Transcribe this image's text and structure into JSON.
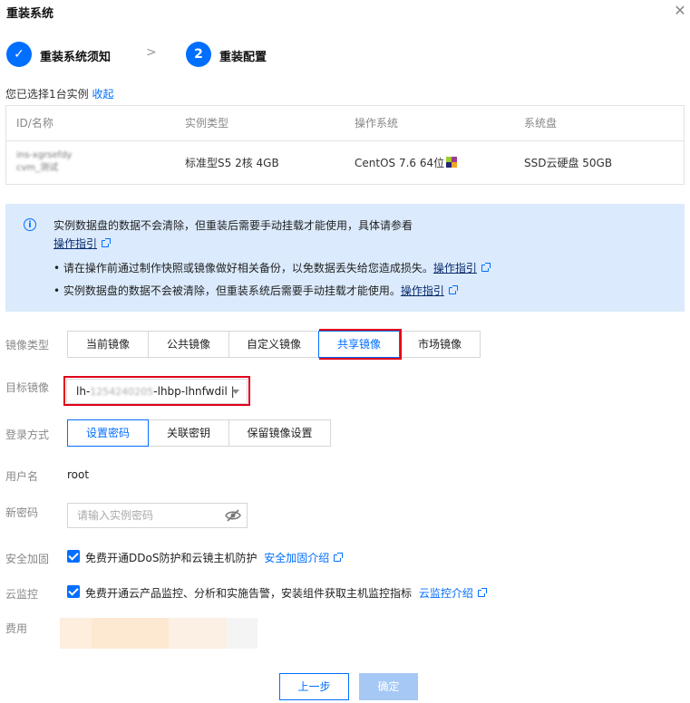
{
  "dialog": {
    "title": "重装系统"
  },
  "steps": [
    {
      "label": "重装系统须知",
      "state": "done"
    },
    {
      "number": "2",
      "label": "重装配置",
      "state": "active"
    }
  ],
  "selection": {
    "prefix": "您已选择1台实例",
    "collapse_link": "收起"
  },
  "instance_table": {
    "headers": [
      "ID/名称",
      "实例类型",
      "操作系统",
      "系统盘"
    ],
    "row": {
      "id_name_line1": "ins-xgrsefdy",
      "id_name_line2": "cvm_测试",
      "type": "标准型S5 2核 4GB",
      "os": "CentOS 7.6 64位",
      "disk": "SSD云硬盘 50GB"
    }
  },
  "notice": {
    "line1": "实例数据盘的数据不会清除，但重装后需要手动挂载才能使用，具体请参看",
    "link1": "操作指引",
    "bullet1": "请在操作前通过制作快照或镜像做好相关备份，以免数据丢失给您造成损失。",
    "bullet1_link": "操作指引",
    "bullet2": "实例数据盘的数据不会被清除，但重装系统后需要手动挂载才能使用。",
    "bullet2_link": "操作指引"
  },
  "image_type": {
    "label": "镜像类型",
    "options": [
      "当前镜像",
      "公共镜像",
      "自定义镜像",
      "共享镜像",
      "市场镜像"
    ],
    "selected": "共享镜像"
  },
  "target_image": {
    "label": "目标镜像",
    "value_prefix": "lh-",
    "value_blurred": "1254240205",
    "value_suffix": "-lhbp-lhnfwdil |"
  },
  "login": {
    "label": "登录方式",
    "options": [
      "设置密码",
      "关联密钥",
      "保留镜像设置"
    ],
    "selected": "设置密码"
  },
  "username": {
    "label": "用户名",
    "value": "root"
  },
  "new_password": {
    "label": "新密码",
    "placeholder": "请输入实例密码"
  },
  "security": {
    "label": "安全加固",
    "text": "免费开通DDoS防护和云镜主机防护",
    "link": "安全加固介绍"
  },
  "monitor": {
    "label": "云监控",
    "text": "免费开通云产品监控、分析和实施告警，安装组件获取主机监控指标",
    "link": "云监控介绍"
  },
  "fee": {
    "label": "费用"
  },
  "footer": {
    "prev": "上一步",
    "confirm": "确定"
  },
  "colors": {
    "primary": "#006eff",
    "highlight": "#e0001b",
    "notice_bg": "#dbeafc",
    "disabled_btn": "#a6c8f5"
  }
}
